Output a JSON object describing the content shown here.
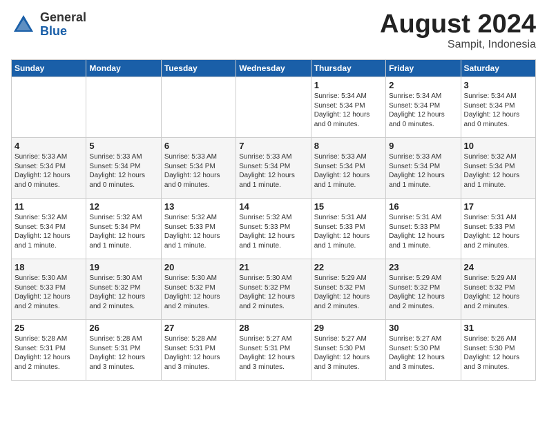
{
  "header": {
    "logo_general": "General",
    "logo_blue": "Blue",
    "title": "August 2024",
    "subtitle": "Sampit, Indonesia"
  },
  "days_of_week": [
    "Sunday",
    "Monday",
    "Tuesday",
    "Wednesday",
    "Thursday",
    "Friday",
    "Saturday"
  ],
  "weeks": [
    [
      {
        "day": "",
        "info": ""
      },
      {
        "day": "",
        "info": ""
      },
      {
        "day": "",
        "info": ""
      },
      {
        "day": "",
        "info": ""
      },
      {
        "day": "1",
        "info": "Sunrise: 5:34 AM\nSunset: 5:34 PM\nDaylight: 12 hours\nand 0 minutes."
      },
      {
        "day": "2",
        "info": "Sunrise: 5:34 AM\nSunset: 5:34 PM\nDaylight: 12 hours\nand 0 minutes."
      },
      {
        "day": "3",
        "info": "Sunrise: 5:34 AM\nSunset: 5:34 PM\nDaylight: 12 hours\nand 0 minutes."
      }
    ],
    [
      {
        "day": "4",
        "info": "Sunrise: 5:33 AM\nSunset: 5:34 PM\nDaylight: 12 hours\nand 0 minutes."
      },
      {
        "day": "5",
        "info": "Sunrise: 5:33 AM\nSunset: 5:34 PM\nDaylight: 12 hours\nand 0 minutes."
      },
      {
        "day": "6",
        "info": "Sunrise: 5:33 AM\nSunset: 5:34 PM\nDaylight: 12 hours\nand 0 minutes."
      },
      {
        "day": "7",
        "info": "Sunrise: 5:33 AM\nSunset: 5:34 PM\nDaylight: 12 hours\nand 1 minute."
      },
      {
        "day": "8",
        "info": "Sunrise: 5:33 AM\nSunset: 5:34 PM\nDaylight: 12 hours\nand 1 minute."
      },
      {
        "day": "9",
        "info": "Sunrise: 5:33 AM\nSunset: 5:34 PM\nDaylight: 12 hours\nand 1 minute."
      },
      {
        "day": "10",
        "info": "Sunrise: 5:32 AM\nSunset: 5:34 PM\nDaylight: 12 hours\nand 1 minute."
      }
    ],
    [
      {
        "day": "11",
        "info": "Sunrise: 5:32 AM\nSunset: 5:34 PM\nDaylight: 12 hours\nand 1 minute."
      },
      {
        "day": "12",
        "info": "Sunrise: 5:32 AM\nSunset: 5:34 PM\nDaylight: 12 hours\nand 1 minute."
      },
      {
        "day": "13",
        "info": "Sunrise: 5:32 AM\nSunset: 5:33 PM\nDaylight: 12 hours\nand 1 minute."
      },
      {
        "day": "14",
        "info": "Sunrise: 5:32 AM\nSunset: 5:33 PM\nDaylight: 12 hours\nand 1 minute."
      },
      {
        "day": "15",
        "info": "Sunrise: 5:31 AM\nSunset: 5:33 PM\nDaylight: 12 hours\nand 1 minute."
      },
      {
        "day": "16",
        "info": "Sunrise: 5:31 AM\nSunset: 5:33 PM\nDaylight: 12 hours\nand 1 minute."
      },
      {
        "day": "17",
        "info": "Sunrise: 5:31 AM\nSunset: 5:33 PM\nDaylight: 12 hours\nand 2 minutes."
      }
    ],
    [
      {
        "day": "18",
        "info": "Sunrise: 5:30 AM\nSunset: 5:33 PM\nDaylight: 12 hours\nand 2 minutes."
      },
      {
        "day": "19",
        "info": "Sunrise: 5:30 AM\nSunset: 5:32 PM\nDaylight: 12 hours\nand 2 minutes."
      },
      {
        "day": "20",
        "info": "Sunrise: 5:30 AM\nSunset: 5:32 PM\nDaylight: 12 hours\nand 2 minutes."
      },
      {
        "day": "21",
        "info": "Sunrise: 5:30 AM\nSunset: 5:32 PM\nDaylight: 12 hours\nand 2 minutes."
      },
      {
        "day": "22",
        "info": "Sunrise: 5:29 AM\nSunset: 5:32 PM\nDaylight: 12 hours\nand 2 minutes."
      },
      {
        "day": "23",
        "info": "Sunrise: 5:29 AM\nSunset: 5:32 PM\nDaylight: 12 hours\nand 2 minutes."
      },
      {
        "day": "24",
        "info": "Sunrise: 5:29 AM\nSunset: 5:32 PM\nDaylight: 12 hours\nand 2 minutes."
      }
    ],
    [
      {
        "day": "25",
        "info": "Sunrise: 5:28 AM\nSunset: 5:31 PM\nDaylight: 12 hours\nand 2 minutes."
      },
      {
        "day": "26",
        "info": "Sunrise: 5:28 AM\nSunset: 5:31 PM\nDaylight: 12 hours\nand 3 minutes."
      },
      {
        "day": "27",
        "info": "Sunrise: 5:28 AM\nSunset: 5:31 PM\nDaylight: 12 hours\nand 3 minutes."
      },
      {
        "day": "28",
        "info": "Sunrise: 5:27 AM\nSunset: 5:31 PM\nDaylight: 12 hours\nand 3 minutes."
      },
      {
        "day": "29",
        "info": "Sunrise: 5:27 AM\nSunset: 5:30 PM\nDaylight: 12 hours\nand 3 minutes."
      },
      {
        "day": "30",
        "info": "Sunrise: 5:27 AM\nSunset: 5:30 PM\nDaylight: 12 hours\nand 3 minutes."
      },
      {
        "day": "31",
        "info": "Sunrise: 5:26 AM\nSunset: 5:30 PM\nDaylight: 12 hours\nand 3 minutes."
      }
    ]
  ]
}
